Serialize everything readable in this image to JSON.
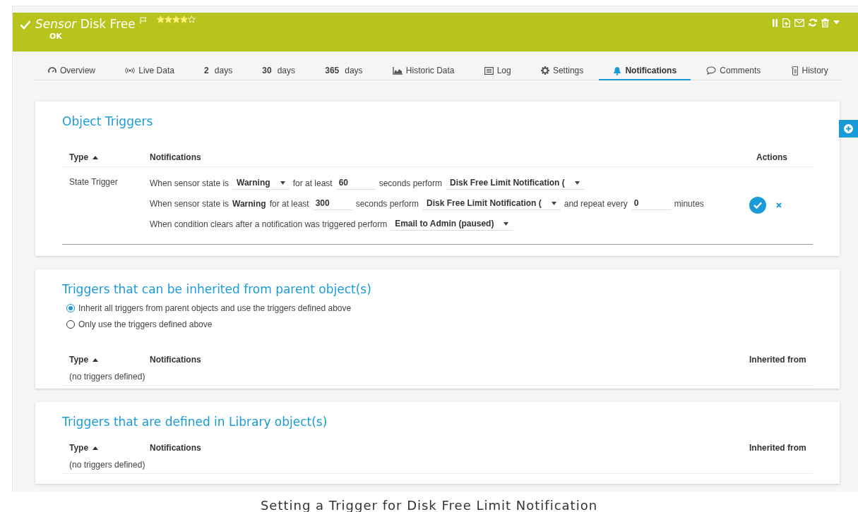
{
  "header": {
    "title_prefix": "Sensor",
    "title": "Disk Free",
    "status": "OK",
    "stars": 4
  },
  "tabs": [
    {
      "label": "Overview",
      "selected": false
    },
    {
      "label": "Live Data",
      "selected": false
    },
    {
      "number": "2",
      "label": "days",
      "selected": false
    },
    {
      "number": "30",
      "label": "days",
      "selected": false
    },
    {
      "number": "365",
      "label": "days",
      "selected": false
    },
    {
      "label": "Historic Data",
      "selected": false
    },
    {
      "label": "Log",
      "selected": false
    },
    {
      "label": "Settings",
      "selected": false
    },
    {
      "label": "Notifications",
      "selected": true
    },
    {
      "label": "Comments",
      "selected": false
    },
    {
      "label": "History",
      "selected": false
    }
  ],
  "object_triggers": {
    "title": "Object Triggers",
    "columns": [
      "Type",
      "Notifications",
      "Actions"
    ],
    "rows": [
      {
        "type": "State Trigger",
        "lines": [
          [
            {
              "kind": "text",
              "text": "When sensor state is"
            },
            {
              "kind": "select",
              "text": "Warning"
            },
            {
              "kind": "text",
              "text": "for at least"
            },
            {
              "kind": "input",
              "text": "60"
            },
            {
              "kind": "text",
              "text": "seconds perform"
            },
            {
              "kind": "select",
              "text": "Disk Free Limit Notification ("
            }
          ],
          [
            {
              "kind": "text",
              "text": "When sensor state is"
            },
            {
              "kind": "bold",
              "text": "Warning"
            },
            {
              "kind": "text",
              "text": "for at least"
            },
            {
              "kind": "input",
              "text": "300"
            },
            {
              "kind": "text",
              "text": "seconds perform"
            },
            {
              "kind": "select",
              "text": "Disk Free Limit Notification ("
            },
            {
              "kind": "text",
              "text": "and repeat every"
            },
            {
              "kind": "input",
              "text": "0"
            },
            {
              "kind": "text",
              "text": "minutes"
            }
          ],
          [
            {
              "kind": "text",
              "text": "When condition clears after a notification was triggered perform"
            },
            {
              "kind": "select",
              "text": "Email to Admin (paused)"
            }
          ]
        ]
      }
    ]
  },
  "inherited_triggers": {
    "title": "Triggers that can be inherited from parent object(s)",
    "options": [
      {
        "label": "Inherit all triggers from parent objects and use the triggers defined above",
        "selected": true
      },
      {
        "label": "Only use the triggers defined above",
        "selected": false
      }
    ],
    "columns": [
      "Type",
      "Notifications",
      "Inherited from"
    ],
    "empty": "(no triggers defined)"
  },
  "library_triggers": {
    "title": "Triggers that are defined in Library object(s)",
    "columns": [
      "Type",
      "Notifications",
      "Inherited from"
    ],
    "empty": "(no triggers defined)"
  },
  "caption": "Setting a Trigger for Disk Free Limit Notification"
}
